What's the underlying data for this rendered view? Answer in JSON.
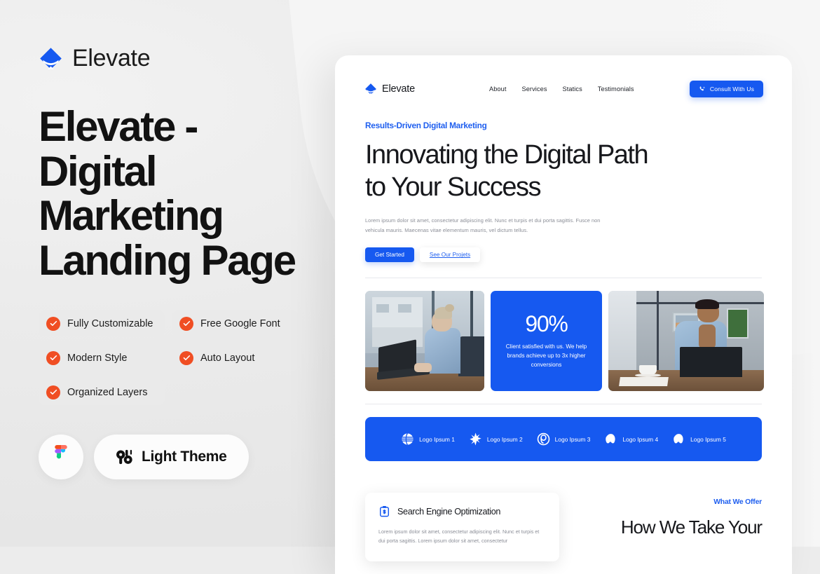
{
  "colors": {
    "accent_blue": "#1659f0",
    "accent_blue_text": "#1f5fef",
    "check_orange": "#f04e23",
    "background": "#ececec",
    "card_white": "#ffffff",
    "title_black": "#121212",
    "muted_gray": "#8b8e97"
  },
  "left_panel": {
    "brand_name": "Elevate",
    "brand_logo_icon": "elevate-layers-logo-icon",
    "title": "Elevate - Digital Marketing Landing Page",
    "tags": [
      {
        "label": "Fully Customizable",
        "icon": "check-circle-icon"
      },
      {
        "label": "Free Google Font",
        "icon": "check-circle-icon"
      },
      {
        "label": "Modern Style",
        "icon": "check-circle-icon"
      },
      {
        "label": "Auto Layout",
        "icon": "check-circle-icon"
      },
      {
        "label": "Organized Layers",
        "icon": "check-circle-icon"
      }
    ],
    "figma_button": {
      "icon": "figma-logo-icon",
      "label": ""
    },
    "theme_button": {
      "icon": "theme-sliders-icon",
      "label": "Light Theme"
    }
  },
  "mockup": {
    "nav": {
      "brand_name": "Elevate",
      "brand_logo_icon": "elevate-layers-logo-icon",
      "links": [
        "About",
        "Services",
        "Statics",
        "Testimonials"
      ],
      "cta": {
        "label": "Consult With Us",
        "icon": "phone-call-icon"
      }
    },
    "hero": {
      "eyebrow": "Results-Driven Digital Marketing",
      "heading_line1": "Innovating the Digital Path",
      "heading_line2": "to Your Success",
      "paragraph": "Lorem ipsum dolor sit amet, consectetur adipiscing elit. Nunc et turpis et dui porta sagittis. Fusce non vehicula mauris. Maecenas vitae elementum mauris, vel dictum tellus.",
      "primary_button": "Get Started",
      "secondary_button": "See Our Projets"
    },
    "stat_cards": {
      "image_left_alt": "woman working on laptop by office window",
      "image_right_alt": "man thinking at desk with laptop and coffee",
      "stat_number": "90%",
      "stat_text": "Client satisfied with us. We help brands achieve up to 3x higher conversions"
    },
    "logo_strip": [
      {
        "label": "Logo Ipsum 1",
        "icon": "globe-stripes-icon"
      },
      {
        "label": "Logo Ipsum 2",
        "icon": "eight-point-star-icon"
      },
      {
        "label": "Logo Ipsum 3",
        "icon": "spiral-circle-icon"
      },
      {
        "label": "Logo Ipsum 4",
        "icon": "cloud-blob-icon"
      },
      {
        "label": "Logo Ipsum 5",
        "icon": "cloud-blob-icon"
      }
    ],
    "service_card": {
      "icon": "clipboard-dollar-icon",
      "title": "Search Engine Optimization",
      "paragraph": "Lorem ipsum dolor sit amet, consectetur adipiscing elit. Nunc et turpis et dui porta sagittis. Lorem ipsum dolor sit amet, consectetur"
    },
    "offer": {
      "eyebrow": "What We Offer",
      "heading": "How We Take Your"
    }
  }
}
